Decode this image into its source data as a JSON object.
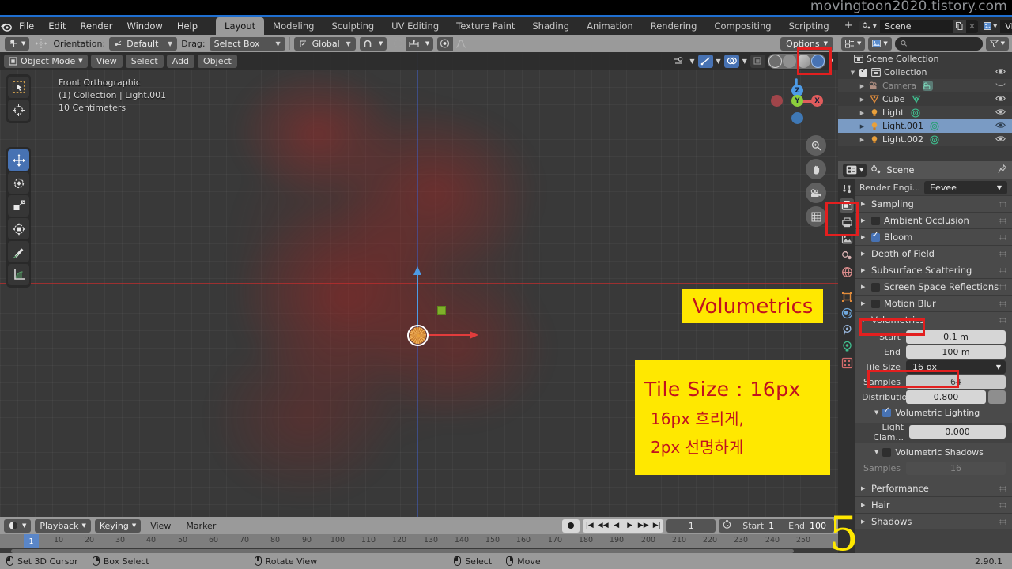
{
  "watermark": "movingtoon2020.tistory.com",
  "topbar": {
    "logo_icon": "blender-logo-icon",
    "menus": [
      "File",
      "Edit",
      "Render",
      "Window",
      "Help"
    ],
    "workspace_tabs": [
      "Layout",
      "Modeling",
      "Sculpting",
      "UV Editing",
      "Texture Paint",
      "Shading",
      "Animation",
      "Rendering",
      "Compositing",
      "Scripting"
    ],
    "active_workspace": "Layout",
    "add_workspace": "+",
    "scene_label": "Scene",
    "view_layer_label": "View Layer",
    "scene_icon": "scene-icon",
    "view_layer_icon": "image-icon",
    "copy_icon": "duplicate-icon",
    "close_icon": "x-icon"
  },
  "tool_header": {
    "tool_icon": "transform-tool-icon",
    "snap_icon": "snap-move-icon",
    "orientation_label": "Orientation:",
    "orientation_value": "Default",
    "orientation_icon": "axis-icon",
    "drag_label": "Drag:",
    "drag_value": "Select Box",
    "transform_orientation_icon": "orientation-gizmo-icon",
    "global_value": "Global",
    "snap_magnet_icon": "magnet-icon",
    "snap_target_icon": "snap-increment-icon",
    "proportional_icon": "proportional-edit-icon",
    "falloff_icon": "smooth-falloff-icon",
    "options_label": "Options"
  },
  "properties_header": {
    "filter_icon": "filter-icon",
    "display_mode_icon": "outliner-display-icon",
    "image_icon": "image-icon",
    "search_icon": "search-icon",
    "search_placeholder": ""
  },
  "viewport": {
    "mode_label": "Object Mode",
    "mode_icon": "object-mode-icon",
    "menus": [
      "View",
      "Select",
      "Add",
      "Object"
    ],
    "overlay_icons": [
      "visibility-icon",
      "gizmo-icon",
      "overlays-icon",
      "xray-icon"
    ],
    "shading_modes": [
      "wireframe-shading-icon",
      "solid-shading-icon",
      "material-preview-icon",
      "rendered-shading-icon"
    ],
    "active_shading": "rendered-shading-icon",
    "info_lines": [
      "Front Orthographic",
      "(1) Collection | Light.001",
      "10 Centimeters"
    ],
    "toolbar_top": [
      "tweak-select-icon",
      "cursor-tool-icon"
    ],
    "toolbar_tools": [
      "move-tool-icon",
      "rotate-tool-icon",
      "scale-tool-icon",
      "transform-tool-icon",
      "annotate-tool-icon",
      "measure-tool-icon"
    ],
    "active_tool": "move-tool-icon",
    "nav_buttons": [
      "zoom-icon",
      "pan-hand-icon",
      "camera-view-icon",
      "ortho-persp-toggle-icon"
    ],
    "gizmo_axes": [
      "Z",
      "Y",
      "X"
    ],
    "cursor_icon": "3d-cursor-icon"
  },
  "annotations": {
    "title": "Volumetrics",
    "line1": "Tile Size :  16px",
    "line2": "16px 흐리게,",
    "line3": "2px 선명하게",
    "step_number": "5",
    "highlight_color": "#e31f1f",
    "note_bg": "#ffe800",
    "note_fg": "#c1121f"
  },
  "outliner": {
    "root": {
      "label": "Scene Collection",
      "icon": "collection-icon"
    },
    "items": [
      {
        "label": "Collection",
        "icon": "collection-icon",
        "indent": 1,
        "checkbox": true,
        "disclosure": "open",
        "eye": true,
        "selected": false,
        "dim": false
      },
      {
        "label": "Camera",
        "icon": "camera-data-icon",
        "badge": "camera-object-icon",
        "indent": 2,
        "disclosure": "closed",
        "eye": true,
        "selected": false,
        "dim": true
      },
      {
        "label": "Cube",
        "icon": "mesh-data-icon",
        "badge": "mesh-object-icon",
        "indent": 2,
        "disclosure": "closed",
        "eye": true,
        "selected": false,
        "dim": false
      },
      {
        "label": "Light",
        "icon": "light-object-icon",
        "badge": "light-data-icon",
        "indent": 2,
        "disclosure": "closed",
        "eye": true,
        "selected": false,
        "dim": false
      },
      {
        "label": "Light.001",
        "icon": "light-object-icon",
        "badge": "light-data-icon",
        "indent": 2,
        "disclosure": "closed",
        "eye": true,
        "selected": true,
        "dim": false
      },
      {
        "label": "Light.002",
        "icon": "light-object-icon",
        "badge": "light-data-icon",
        "indent": 2,
        "disclosure": "closed",
        "eye": true,
        "selected": false,
        "dim": false
      }
    ]
  },
  "properties": {
    "header_title": "Scene",
    "header_icon": "scene-icon",
    "editor_type_icon": "properties-editor-icon",
    "pin_icon": "pin-icon",
    "tabs": [
      "tool-tab-icon",
      "render-tab-icon",
      "output-tab-icon",
      "view-layer-tab-icon",
      "scene-tab-icon",
      "world-tab-icon",
      "object-tab-icon",
      "modifier-tab-icon",
      "physics-tab-icon",
      "data-tab-icon",
      "material-tab-icon"
    ],
    "active_tab": "render-tab-icon",
    "render_engine_label": "Render Engi...",
    "render_engine_value": "Eevee",
    "panels": [
      {
        "label": "Sampling",
        "open": false,
        "checkbox": null
      },
      {
        "label": "Ambient Occlusion",
        "open": false,
        "checkbox": false
      },
      {
        "label": "Bloom",
        "open": false,
        "checkbox": true
      },
      {
        "label": "Depth of Field",
        "open": false,
        "checkbox": null
      },
      {
        "label": "Subsurface Scattering",
        "open": false,
        "checkbox": null
      },
      {
        "label": "Screen Space Reflections",
        "open": false,
        "checkbox": false
      },
      {
        "label": "Motion Blur",
        "open": false,
        "checkbox": false
      },
      {
        "label": "Volumetrics",
        "open": true,
        "checkbox": null
      }
    ],
    "volumetrics": {
      "start_label": "Start",
      "start_value": "0.1 m",
      "end_label": "End",
      "end_value": "100 m",
      "tile_size_label": "Tile Size",
      "tile_size_value": "16 px",
      "samples_label": "Samples",
      "samples_value": "64",
      "distribution_label": "Distribution",
      "distribution_value": "0.800",
      "volumetric_lighting_label": "Volumetric Lighting",
      "volumetric_lighting_checked": true,
      "light_clamp_label": "Light Clam...",
      "light_clamp_value": "0.000",
      "volumetric_shadows_label": "Volumetric Shadows",
      "volumetric_shadows_checked": false,
      "shadow_samples_label": "Samples",
      "shadow_samples_value": "16"
    },
    "bottom_panels": [
      {
        "label": "Performance"
      },
      {
        "label": "Hair"
      },
      {
        "label": "Shadows"
      }
    ]
  },
  "timeline": {
    "editor_icon": "timeline-editor-icon",
    "playback_label": "Playback",
    "keying_label": "Keying",
    "menus": [
      "View",
      "Marker"
    ],
    "record_icon": "record-icon",
    "transport_icons": [
      "jump-start-icon",
      "prev-keyframe-icon",
      "play-reverse-icon",
      "play-icon",
      "next-keyframe-icon",
      "jump-end-icon"
    ],
    "current_frame": "1",
    "timer_icon": "timer-icon",
    "start_label": "Start",
    "start_value": "1",
    "end_label": "End",
    "end_value": "100",
    "ruler_ticks": [
      "10",
      "20",
      "30",
      "40",
      "50",
      "60",
      "70",
      "80",
      "90",
      "100",
      "110",
      "120",
      "130",
      "140",
      "150",
      "160",
      "170",
      "180",
      "190",
      "200",
      "210",
      "220",
      "230",
      "240",
      "250"
    ],
    "playhead_label": "1"
  },
  "statusbar": {
    "items": [
      {
        "mouse": "left",
        "label": "Set 3D Cursor"
      },
      {
        "mouse": "right",
        "label": "Box Select"
      },
      {
        "mouse": "middle",
        "label": "Rotate View"
      },
      {
        "mouse": "left",
        "label": "Select"
      },
      {
        "mouse": "right",
        "label": "Move"
      }
    ],
    "version": "2.90.1"
  }
}
